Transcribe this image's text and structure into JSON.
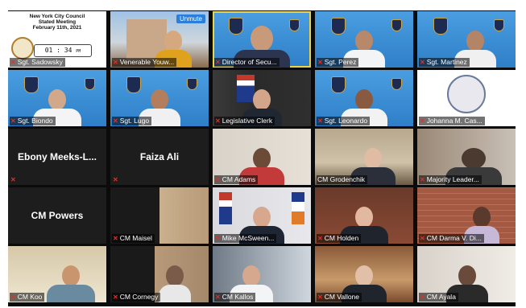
{
  "meeting": {
    "title_line1": "New York City Council",
    "title_line2": "Stated Meeting",
    "date": "February 11th, 2021",
    "clock": "01 : 34",
    "clock_suffix": "PM"
  },
  "unmute_label": "Unmute",
  "tiles": [
    {
      "name": "Sgt. Sadowsky",
      "muted": true
    },
    {
      "name": "Venerable Youw...",
      "muted": true
    },
    {
      "name": "Director of Secu...",
      "muted": true,
      "active": true
    },
    {
      "name": "Sgt. Perez",
      "muted": true
    },
    {
      "name": "Sgt. Martinez",
      "muted": true
    },
    {
      "name": "Sgt. Biondo",
      "muted": true
    },
    {
      "name": "Sgt. Lugo",
      "muted": true
    },
    {
      "name": "Legislative Clerk",
      "muted": true
    },
    {
      "name": "Sgt. Leonardo",
      "muted": true
    },
    {
      "name": "Johanna M. Cas...",
      "muted": true
    },
    {
      "name": "Ebony Meeks-L...",
      "muted": true,
      "display_name": "Ebony Meeks-L..."
    },
    {
      "name": "Faiza Ali",
      "muted": true,
      "display_name": "Faiza Ali"
    },
    {
      "name": "CM Adams",
      "muted": true
    },
    {
      "name": "CM Grodenchik",
      "muted": false
    },
    {
      "name": "Majority Leader...",
      "muted": true
    },
    {
      "name": "CM Powers",
      "muted": false,
      "display_name": "CM Powers"
    },
    {
      "name": "CM Maisel",
      "muted": true
    },
    {
      "name": "Mike McSween...",
      "muted": true
    },
    {
      "name": "CM Holden",
      "muted": true
    },
    {
      "name": "CM Darma V. Di...",
      "muted": true
    },
    {
      "name": "CM Koo",
      "muted": true
    },
    {
      "name": "CM Cornegy",
      "muted": true
    },
    {
      "name": "CM Kallos",
      "muted": true
    },
    {
      "name": "CM Vallone",
      "muted": true
    },
    {
      "name": "CM Ayala",
      "muted": true
    }
  ]
}
